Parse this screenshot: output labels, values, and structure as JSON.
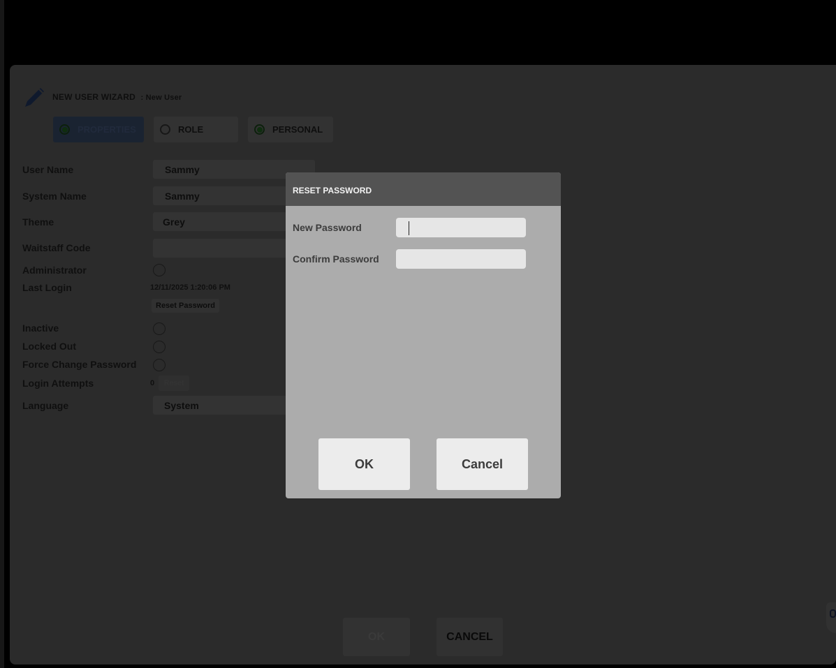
{
  "wizard": {
    "title": "NEW USER WIZARD",
    "subtitle": ": New User",
    "tabs": [
      {
        "label": "PROPERTIES",
        "selected": true
      },
      {
        "label": "ROLE",
        "selected": false
      },
      {
        "label": "PERSONAL",
        "selected": true
      }
    ],
    "fields": {
      "user_name": {
        "label": "User Name",
        "value": "Sammy"
      },
      "system_name": {
        "label": "System Name",
        "value": "Sammy"
      },
      "theme": {
        "label": "Theme",
        "value": "Grey"
      },
      "waitstaff_code": {
        "label": "Waitstaff Code",
        "value": ""
      },
      "administrator": {
        "label": "Administrator"
      },
      "last_login": {
        "label": "Last Login",
        "value": "12/11/2025 1:20:06 PM"
      },
      "reset_password_label": "Reset Password",
      "inactive": {
        "label": "Inactive"
      },
      "locked_out": {
        "label": "Locked Out"
      },
      "force_change_password": {
        "label": "Force Change Password"
      },
      "login_attempts": {
        "label": "Login Attempts",
        "value": "0",
        "reset_label": "Reset"
      },
      "language": {
        "label": "Language",
        "value": "System"
      }
    },
    "footer": {
      "ok_label": "OK",
      "cancel_label": "CANCEL"
    }
  },
  "dialog": {
    "title": "RESET PASSWORD",
    "new_password": {
      "label": "New Password",
      "value": ""
    },
    "confirm_password": {
      "label": "Confirm Password",
      "value": ""
    },
    "ok_label": "OK",
    "cancel_label": "Cancel"
  },
  "colors": {
    "dialog_header": "#535353",
    "dialog_body": "#acacac",
    "active_tab": "#30405a",
    "radio_selected": "#1d531d"
  }
}
